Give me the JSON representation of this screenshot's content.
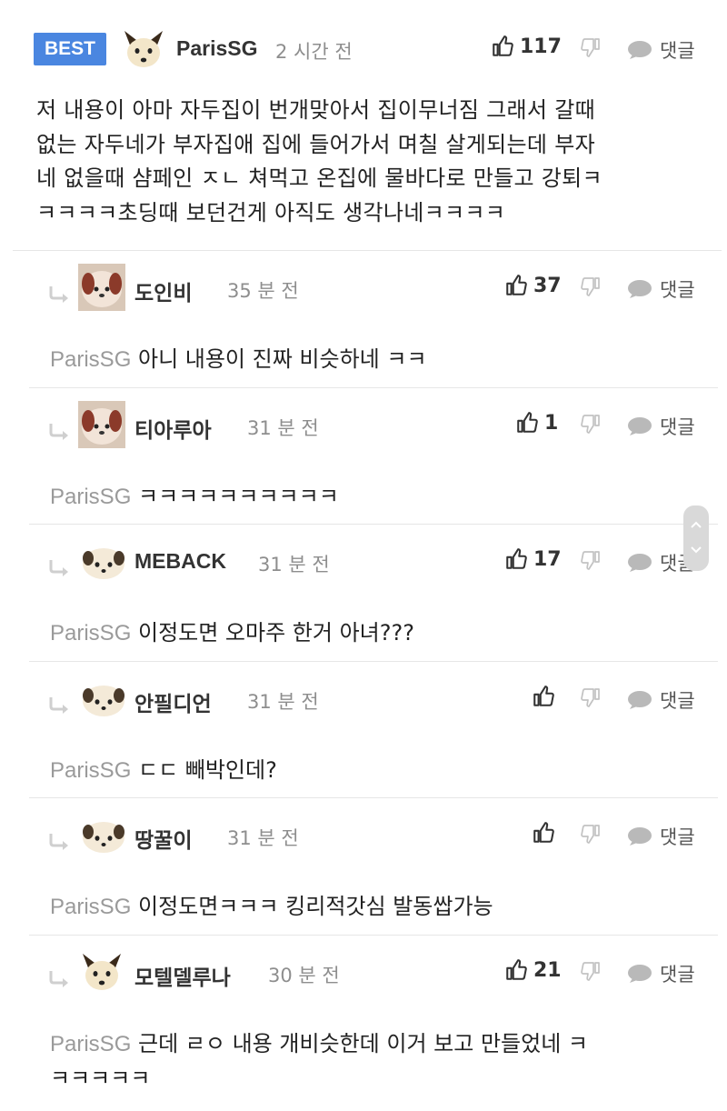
{
  "best": {
    "badge": "BEST",
    "username": "ParisSG",
    "time": "2 시간 전",
    "likes": "117",
    "reply_label": "댓글",
    "lines": [
      "저 내용이 아마 자두집이 번개맞아서 집이무너짐 그래서 갈때",
      "없는 자두네가 부자집애 집에 들어가서 며칠 살게되는데 부자",
      "네 없을때 샴페인 ㅈㄴ 쳐먹고 온집에 물바다로 만들고 강퇴ㅋ",
      "ㅋㅋㅋㅋ초딩때 보던건게 아직도 생각나네ㅋㅋㅋㅋ"
    ]
  },
  "replies": [
    {
      "username": "도인비",
      "time": "35 분 전",
      "likes": "37",
      "reply_label": "댓글",
      "mention": "ParisSG",
      "text": " 아니 내용이 진짜 비슷하네 ㅋㅋ"
    },
    {
      "username": "티아루아",
      "time": "31 분 전",
      "likes": "1",
      "reply_label": "댓글",
      "mention": "ParisSG",
      "text": " ㅋㅋㅋㅋㅋㅋㅋㅋㅋㅋ"
    },
    {
      "username": "MEBACK",
      "time": "31 분 전",
      "likes": "17",
      "reply_label": "댓글",
      "mention": "ParisSG",
      "text": " 이정도면 오마주 한거 아녀???"
    },
    {
      "username": "안필디언",
      "time": "31 분 전",
      "likes": "",
      "reply_label": "댓글",
      "mention": "ParisSG",
      "text": " ㄷㄷ 빼박인데?"
    },
    {
      "username": "땅꿀이",
      "time": "31 분 전",
      "likes": "",
      "reply_label": "댓글",
      "mention": "ParisSG",
      "text": " 이정도면ㅋㅋㅋ 킹리적갓심 발동쌉가능"
    },
    {
      "username": "모텔델루나",
      "time": "30 분 전",
      "likes": "21",
      "reply_label": "댓글",
      "mention": "ParisSG",
      "text": " 근데 ㄹㅇ 내용 개비슷한데 이거 보고 만들었네 ㅋ",
      "text2": "ㅋㅋㅋㅋㅋ"
    }
  ],
  "icons": {
    "like": "thumbs-up-icon",
    "dislike": "thumbs-down-icon",
    "comment": "speech-bubble-icon",
    "reply_arrow": "reply-arrow-icon",
    "scroll": "scroll-handle-icon"
  },
  "colors": {
    "badge": "#4a86e0",
    "mention": "#9a9a9a",
    "time": "#8e8e8e"
  }
}
